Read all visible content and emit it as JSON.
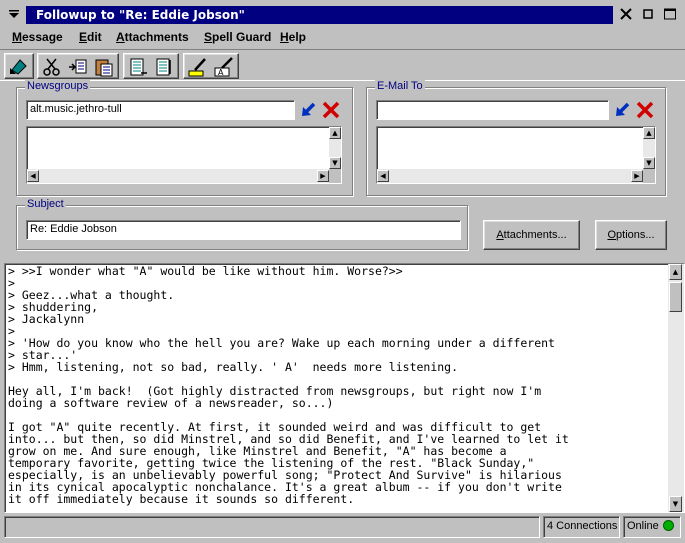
{
  "window": {
    "title": "Followup to \"Re: Eddie Jobson\""
  },
  "menu": [
    {
      "u": "M",
      "rest": "essage"
    },
    {
      "u": "E",
      "rest": "dit"
    },
    {
      "u": "A",
      "rest": "ttachments"
    },
    {
      "u": "S",
      "rest": "pell Guard"
    },
    {
      "u": "H",
      "rest": "elp"
    }
  ],
  "toolbar": {
    "icons": [
      "send-icon",
      "cut-icon",
      "copy-icon",
      "paste-icon",
      "quote-icon",
      "unquote-icon",
      "highlight-icon",
      "font-icon"
    ]
  },
  "newsgroups": {
    "label": "Newsgroups",
    "value": "alt.music.jethro-tull"
  },
  "email_to": {
    "label": "E-Mail To",
    "value": ""
  },
  "subject": {
    "label": "Subject",
    "value": "Re: Eddie Jobson"
  },
  "buttons": {
    "attachments": {
      "u": "A",
      "rest": "ttachments..."
    },
    "options": {
      "u": "O",
      "rest": "ptions..."
    }
  },
  "body": {
    "text": "> >>I wonder what \"A\" would be like without him. Worse?>>\n>\n> Geez...what a thought.\n> shuddering,\n> Jackalynn\n>\n> 'How do you know who the hell you are? Wake up each morning under a different\n> star...'\n> Hmm, listening, not so bad, really. ' A'  needs more listening.\n\nHey all, I'm back!  (Got highly distracted from newsgroups, but right now I'm\ndoing a software review of a newsreader, so...)\n\nI got \"A\" quite recently. At first, it sounded weird and was difficult to get\ninto... but then, so did Minstrel, and so did Benefit, and I've learned to let it\ngrow on me. And sure enough, like Minstrel and Benefit, \"A\" has become a\ntemporary favorite, getting twice the listening of the rest. \"Black Sunday,\"\nespecially, is an unbelievably powerful song; \"Protect And Survive\" is hilarious\nin its cynical apocalyptic nonchalance. It's a great album -- if you don't write\nit off immediately because it sounds so different."
  },
  "status": {
    "message": "",
    "connections": "4 Connections",
    "online": "Online"
  },
  "colors": {
    "title_band": "#000080",
    "group_label": "#000080",
    "online_indicator": "#00b000",
    "delete_x": "#d00000",
    "arrow_blue": "#0030c0"
  }
}
